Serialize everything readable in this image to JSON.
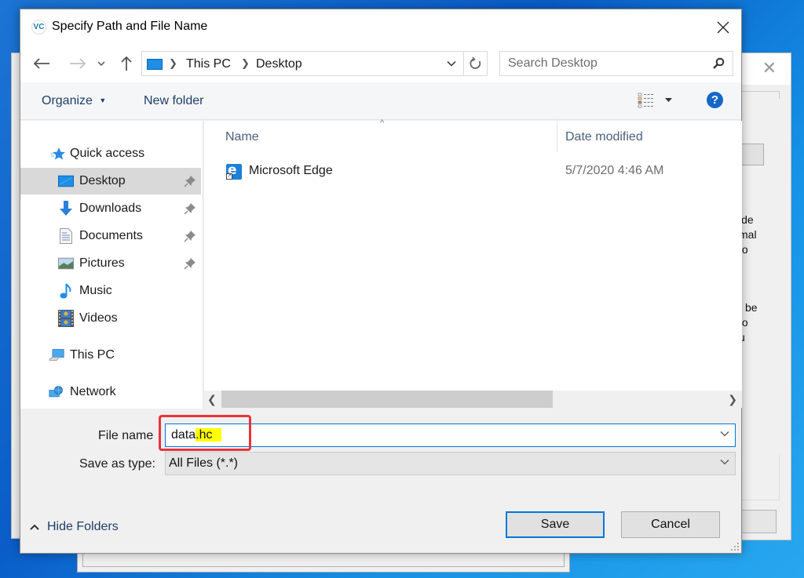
{
  "dialog": {
    "title": "Specify Path and File Name",
    "app_icon": "vc-app-icon"
  },
  "navigation": {
    "back_icon": "arrow-left-icon",
    "forward_icon": "arrow-right-icon",
    "recent_icon": "chevron-down-icon",
    "up_icon": "arrow-up-icon",
    "breadcrumb": [
      "This PC",
      "Desktop"
    ],
    "search_placeholder": "Search Desktop"
  },
  "toolbar": {
    "organize_label": "Organize",
    "new_folder_label": "New folder",
    "help_label": "?"
  },
  "sidebar": {
    "items": [
      {
        "label": "Quick access",
        "icon": "star-icon",
        "pinned": false,
        "selected": false
      },
      {
        "label": "Desktop",
        "icon": "desktop-icon",
        "pinned": true,
        "selected": true
      },
      {
        "label": "Downloads",
        "icon": "download-icon",
        "pinned": true,
        "selected": false
      },
      {
        "label": "Documents",
        "icon": "document-icon",
        "pinned": true,
        "selected": false
      },
      {
        "label": "Pictures",
        "icon": "picture-icon",
        "pinned": true,
        "selected": false
      },
      {
        "label": "Music",
        "icon": "music-icon",
        "pinned": false,
        "selected": false
      },
      {
        "label": "Videos",
        "icon": "video-icon",
        "pinned": false,
        "selected": false
      },
      {
        "label": "This PC",
        "icon": "computer-icon",
        "pinned": false,
        "selected": false
      },
      {
        "label": "Network",
        "icon": "network-icon",
        "pinned": false,
        "selected": false
      }
    ]
  },
  "file_list": {
    "columns": [
      "Name",
      "Date modified"
    ],
    "sort_indicator": "^",
    "rows": [
      {
        "name": "Microsoft Edge",
        "date_modified": "5/7/2020 4:46 AM",
        "icon": "edge-shortcut-icon"
      }
    ]
  },
  "form": {
    "file_name_label": "File name",
    "file_name_base": "data",
    "file_name_ext": ".hc",
    "save_as_type_label": "Save as type:",
    "save_as_type_value": "All Files (*.*)"
  },
  "footer": {
    "hide_folders_label": "Hide Folders",
    "save_label": "Save",
    "cancel_label": "Cancel"
  },
  "background_window": {
    "text_fragments_1": [
      "ide",
      "mal",
      "to"
    ],
    "text_fragments_2": [
      "be",
      "to",
      "u"
    ]
  },
  "colors": {
    "accent": "#0078d7",
    "highlight_box": "#e8343a",
    "text_highlight": "#ffff00",
    "selected_item": "#d9d9d9"
  }
}
